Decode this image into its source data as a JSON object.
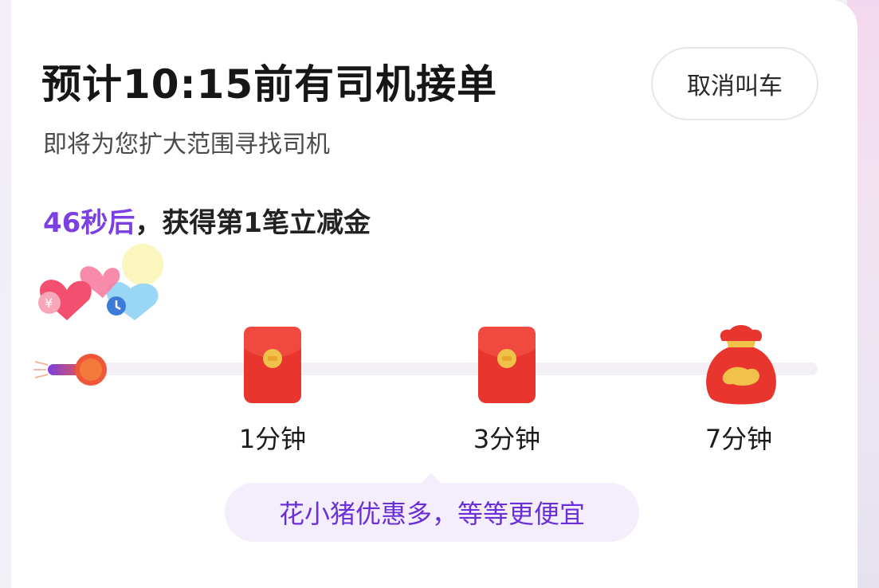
{
  "header": {
    "title": "预计10:15前有司机接单",
    "subtitle": "即将为您扩大范围寻找司机",
    "cancel_label": "取消叫车"
  },
  "countdown": {
    "highlight": "46秒后",
    "rest": "，获得第1笔立减金"
  },
  "milestones": [
    {
      "label": "1分钟",
      "reward_icon": "red-envelope-icon"
    },
    {
      "label": "3分钟",
      "reward_icon": "red-envelope-icon"
    },
    {
      "label": "7分钟",
      "reward_icon": "money-bag-icon"
    }
  ],
  "tip": "花小猪优惠多，等等更便宜",
  "colors": {
    "accent_purple": "#7b3fe4",
    "tip_background": "#f4eefc",
    "red_envelope": "#e8352e",
    "gold": "#f1c24a"
  }
}
